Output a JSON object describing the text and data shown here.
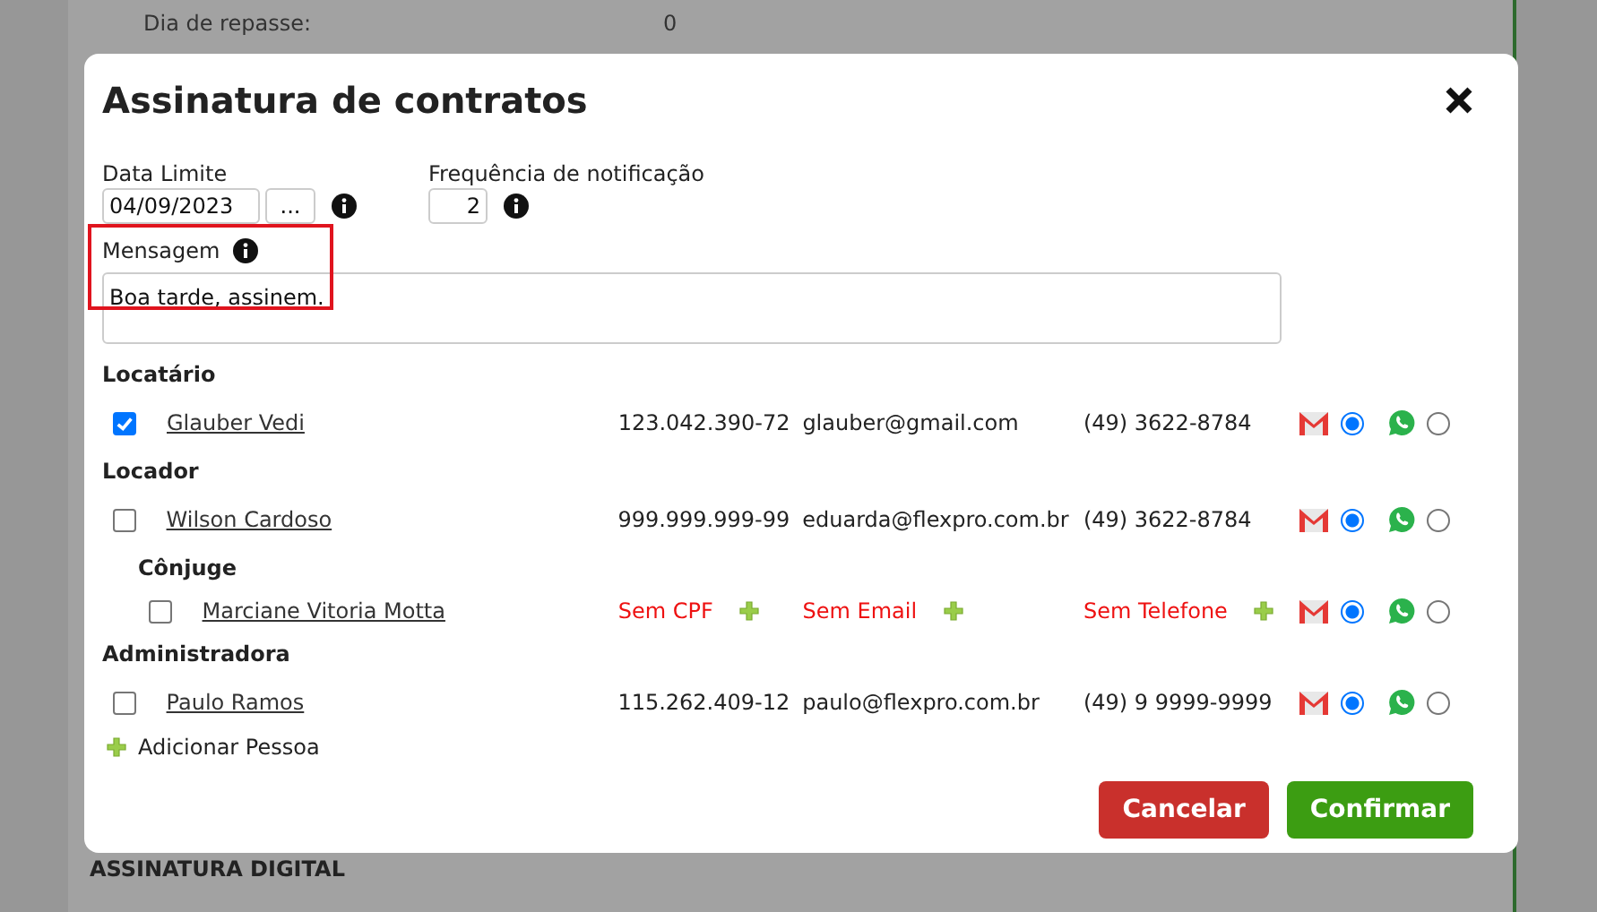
{
  "background": {
    "field_label": "Dia de repasse:",
    "field_value": "0",
    "section_title": "ASSINATURA DIGITAL"
  },
  "dialog": {
    "title": "Assinatura de contratos",
    "date_limit": {
      "label": "Data Limite",
      "value": "04/09/2023",
      "button": "..."
    },
    "frequency": {
      "label": "Frequência de notificação",
      "value": "2"
    },
    "message": {
      "label": "Mensagem",
      "value": "Boa tarde, assinem.",
      "highlighted": true
    },
    "groups": [
      {
        "title": "Locatário",
        "people": [
          {
            "name": "Glauber Vedi",
            "checked": true,
            "cpf": {
              "text": "123.042.390-72",
              "missing": false
            },
            "email": {
              "text": "glauber@gmail.com",
              "missing": false
            },
            "phone": {
              "text": "(49) 3622-8784",
              "missing": false
            },
            "channels": [
              {
                "kind": "email",
                "selected": true
              },
              {
                "kind": "whatsapp",
                "selected": false
              }
            ]
          }
        ]
      },
      {
        "title": "Locador",
        "people": [
          {
            "name": "Wilson Cardoso",
            "checked": false,
            "cpf": {
              "text": "999.999.999-99",
              "missing": false
            },
            "email": {
              "text": "eduarda@flexpro.com.br",
              "missing": false
            },
            "phone": {
              "text": "(49) 3622-8784",
              "missing": false
            },
            "channels": [
              {
                "kind": "email",
                "selected": true
              },
              {
                "kind": "whatsapp",
                "selected": false
              }
            ],
            "children": {
              "title": "Cônjuge",
              "people": [
                {
                  "name": "Marciane Vitoria Motta",
                  "checked": false,
                  "cpf": {
                    "text": "Sem CPF",
                    "missing": true
                  },
                  "email": {
                    "text": "Sem Email",
                    "missing": true
                  },
                  "phone": {
                    "text": "Sem Telefone",
                    "missing": true
                  },
                  "channels": [
                    {
                      "kind": "email",
                      "selected": true
                    },
                    {
                      "kind": "whatsapp",
                      "selected": false
                    }
                  ]
                }
              ]
            }
          }
        ]
      },
      {
        "title": "Administradora",
        "people": [
          {
            "name": "Paulo Ramos",
            "checked": false,
            "cpf": {
              "text": "115.262.409-12",
              "missing": false
            },
            "email": {
              "text": "paulo@flexpro.com.br",
              "missing": false
            },
            "phone": {
              "text": "(49) 9 9999-9999",
              "missing": false
            },
            "channels": [
              {
                "kind": "email",
                "selected": true
              },
              {
                "kind": "whatsapp",
                "selected": false
              }
            ]
          }
        ]
      }
    ],
    "add_person": "Adicionar Pessoa",
    "buttons": [
      {
        "label": "Cancelar",
        "kind": "cancel"
      },
      {
        "label": "Confirmar",
        "kind": "confirm"
      }
    ]
  }
}
